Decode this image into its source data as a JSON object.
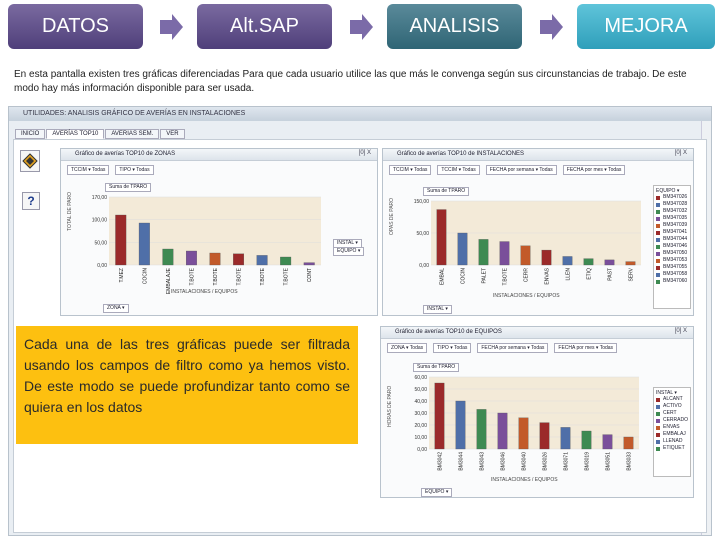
{
  "steps": [
    "DATOS",
    "Alt.SAP",
    "ANALISIS",
    "MEJORA"
  ],
  "intro": "En esta pantalla existen tres gráficas diferenciadas Para que cada usuario utilice las que más le convenga según sus circunstancias de trabajo. De este modo hay más información disponible para ser usada.",
  "app": {
    "title": "UTILIDADES: ANALISIS GRÁFICO DE AVERÍAS EN INSTALACIONES",
    "tabs": [
      "INICIO",
      "AVERÍAS TOP10",
      "AVERIAS SEM.",
      "VER"
    ],
    "help_label": "?"
  },
  "panels": {
    "zonas": {
      "title": "Gráfico de averías TOP10 de ZONAS",
      "ctrl": "[0]  X",
      "filters": [
        "TCCIM ▾ Todas",
        "TIPO ▾ Todas"
      ],
      "sum_label": "Suma de TPARO",
      "ylabel": "TOTAL DE PARO",
      "yticks": [
        "170,00",
        "100,00",
        "50,00",
        "0,00"
      ],
      "xticks": [
        "T.MEZ",
        "COCIN",
        "EMBALAJE",
        "T.BOTE",
        "T.BOTE",
        "T.BOTE",
        "T.BOTE",
        "T.BOTE",
        "CONT"
      ],
      "xlabel": "INSTALACIONES / EQUIPOS",
      "selectors": [
        "INSTAL ▾",
        "EQUIPO ▾"
      ],
      "bottom_sel": "ZONA ▾"
    },
    "instal": {
      "title": "Gráfico de averías TOP10 de INSTALACIONES",
      "ctrl": "[0]  X",
      "filters": [
        "TCCIM ▾ Todas",
        "TCCIM ▾ Todas",
        "FECHA por semana ▾ Todas",
        "FECHA por mes ▾ Todas"
      ],
      "sum_label": "Suma de TPARO",
      "ylabel": "OPAS DE PARO",
      "yticks": [
        "150,00",
        "50,00",
        "0,00"
      ],
      "xticks": [
        "EMBAL",
        "COCIN",
        "PALET",
        "T.BOTE",
        "CERR",
        "ENVAS",
        "LLEN",
        "ETIQ",
        "PAST",
        "SERV"
      ],
      "xlabel": "INSTALACIONES / EQUIPOS",
      "legend_title": "EQUIPO ▾",
      "legend": [
        "BM347026",
        "BM347028",
        "BM347032",
        "BM347035",
        "BM347039",
        "BM347041",
        "BM347044",
        "BM347046",
        "BM347050",
        "BM347053",
        "BM347055",
        "BM347058",
        "BM347060"
      ],
      "bottom_sel": "INSTAL ▾"
    },
    "equipos": {
      "title": "Gráfico de averías TOP10 de EQUIPOS",
      "ctrl": "[0]  X",
      "filters": [
        "ZONA ▾ Todas",
        "TIPO ▾ Todas",
        "FECHA por semana ▾ Todas",
        "FECHA por mes ▾ Todas"
      ],
      "sum_label": "Suma de TPARO",
      "ylabel": "HORAS DE PARO",
      "yticks": [
        "60,00",
        "50,00",
        "40,00",
        "30,00",
        "20,00",
        "10,00",
        "0,00"
      ],
      "xticks": [
        "BM3042",
        "BM3044",
        "BM3043",
        "BM3046",
        "BM3040",
        "BM3026",
        "BM3071",
        "BM3019",
        "BM3051",
        "BM3033"
      ],
      "xlabel": "INSTALACIONES / EQUIPOS",
      "legend_title": "INSTAL ▾",
      "legend": [
        "ALCANT",
        "ACTIVO",
        "CERT",
        "CERRADO",
        "ENVAS",
        "EMBALAJ",
        "LLENAD",
        "ETIQUET"
      ],
      "bottom_sel": "EQUIPO ▾"
    }
  },
  "callout": "Cada una de las tres gráficas puede ser filtrada usando los campos de filtro como ya hemos visto. De este modo se puede profundizar tanto como se quiera en los datos",
  "chart_data": [
    {
      "type": "bar",
      "title": "Gráfico de averías TOP10 de ZONAS",
      "ylabel": "TOTAL DE PARO",
      "xlabel": "INSTALACIONES / EQUIPOS",
      "categories": [
        "T.MEZ",
        "COCIN",
        "EMBALAJE",
        "T.BOTE",
        "T.BOTE",
        "T.BOTE",
        "T.BOTE",
        "T.BOTE",
        "CONT"
      ],
      "values": [
        125,
        105,
        40,
        35,
        30,
        28,
        24,
        20,
        6
      ],
      "ylim": [
        0,
        170
      ]
    },
    {
      "type": "bar",
      "title": "Gráfico de averías TOP10 de INSTALACIONES",
      "ylabel": "OPAS DE PARO",
      "xlabel": "INSTALACIONES / EQUIPOS",
      "categories": [
        "EMBAL",
        "COCIN",
        "PALET",
        "T.BOTE",
        "CERR",
        "ENVAS",
        "LLEN",
        "ETIQ",
        "PAST",
        "SERV"
      ],
      "values": [
        130,
        75,
        60,
        55,
        45,
        35,
        20,
        15,
        12,
        8
      ],
      "ylim": [
        0,
        150
      ]
    },
    {
      "type": "bar",
      "title": "Gráfico de averías TOP10 de EQUIPOS",
      "ylabel": "HORAS DE PARO",
      "xlabel": "INSTALACIONES / EQUIPOS",
      "categories": [
        "BM3042",
        "BM3044",
        "BM3043",
        "BM3046",
        "BM3040",
        "BM3026",
        "BM3071",
        "BM3019",
        "BM3051",
        "BM3033"
      ],
      "values": [
        55,
        40,
        33,
        30,
        26,
        22,
        18,
        15,
        12,
        10
      ],
      "ylim": [
        0,
        60
      ]
    }
  ],
  "colors": {
    "bar1": "#9b2a2a",
    "bar2": "#4f6fa8",
    "bar3": "#3e8a52",
    "bar4": "#7a4f9a",
    "bar5": "#c25a2a",
    "callout": "#fdc010"
  }
}
